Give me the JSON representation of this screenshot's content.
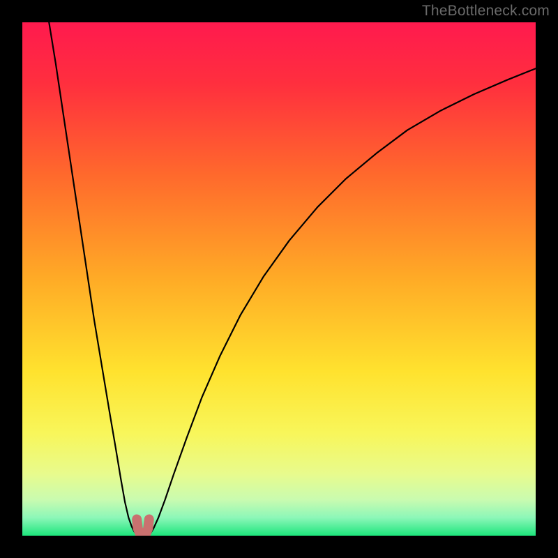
{
  "watermark": "TheBottleneck.com",
  "chart_data": {
    "type": "line",
    "title": "",
    "xlabel": "",
    "ylabel": "",
    "xlim": [
      0,
      100
    ],
    "ylim": [
      0,
      100
    ],
    "grid": false,
    "legend": false,
    "background_gradient_stops": [
      {
        "offset": 0.0,
        "color": "#ff1a4e"
      },
      {
        "offset": 0.12,
        "color": "#ff2f3e"
      },
      {
        "offset": 0.3,
        "color": "#ff6a2c"
      },
      {
        "offset": 0.5,
        "color": "#ffab26"
      },
      {
        "offset": 0.68,
        "color": "#ffe22e"
      },
      {
        "offset": 0.8,
        "color": "#f8f65a"
      },
      {
        "offset": 0.88,
        "color": "#e8fb8d"
      },
      {
        "offset": 0.93,
        "color": "#c9fbb0"
      },
      {
        "offset": 0.965,
        "color": "#8cf7b8"
      },
      {
        "offset": 1.0,
        "color": "#1de57c"
      }
    ],
    "series": [
      {
        "name": "left-branch",
        "x": [
          5.2,
          6.5,
          8.0,
          9.5,
          11.0,
          12.5,
          14.0,
          15.5,
          17.0,
          18.2,
          19.2,
          20.0,
          20.7,
          21.3,
          21.8,
          22.2,
          22.5
        ],
        "y": [
          100,
          92,
          82,
          72,
          62,
          52,
          42,
          33,
          24,
          17,
          11,
          6.5,
          3.5,
          1.8,
          0.8,
          0.3,
          0.0
        ]
      },
      {
        "name": "right-branch",
        "x": [
          24.5,
          25.0,
          25.6,
          26.5,
          27.8,
          29.5,
          32.0,
          35.0,
          38.5,
          42.5,
          47.0,
          52.0,
          57.5,
          63.0,
          69.0,
          75.0,
          81.5,
          88.0,
          94.5,
          100.0
        ],
        "y": [
          0.0,
          0.5,
          1.5,
          3.5,
          7.0,
          12.0,
          19.0,
          27.0,
          35.0,
          43.0,
          50.5,
          57.5,
          64.0,
          69.5,
          74.5,
          79.0,
          82.8,
          86.0,
          88.8,
          91.0
        ]
      }
    ],
    "marker": {
      "name": "valley-marker",
      "shape": "u",
      "color": "#c9716f",
      "stroke_width": 14,
      "points_x": [
        22.3,
        22.5,
        22.9,
        23.5,
        24.1,
        24.5,
        24.7
      ],
      "points_y": [
        3.2,
        1.4,
        0.4,
        0.2,
        0.4,
        1.4,
        3.2
      ]
    }
  }
}
